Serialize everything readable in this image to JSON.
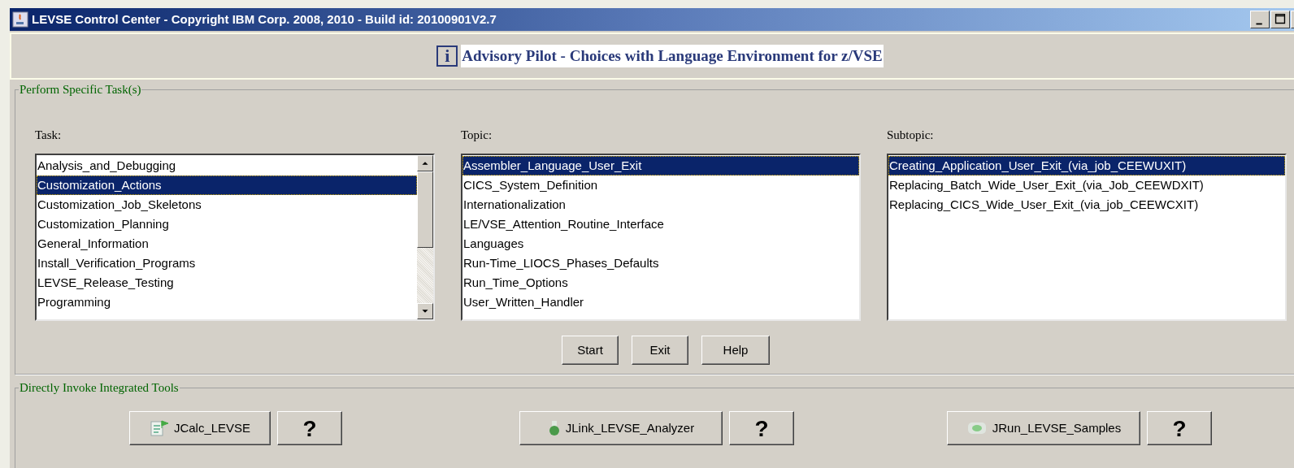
{
  "window": {
    "title": "LEVSE Control Center - Copyright IBM Corp. 2008, 2010 - Build id: 20100901V2.7"
  },
  "header": {
    "info_glyph": "i",
    "text": "Advisory Pilot - Choices with Language Environment for z/VSE"
  },
  "task_group": {
    "title": "Perform Specific Task(s)",
    "lists": [
      {
        "label": "Task:",
        "scrollbar": true,
        "items": [
          {
            "text": "Analysis_and_Debugging",
            "selected": false
          },
          {
            "text": "Customization_Actions",
            "selected": true
          },
          {
            "text": "Customization_Job_Skeletons",
            "selected": false
          },
          {
            "text": "Customization_Planning",
            "selected": false
          },
          {
            "text": "General_Information",
            "selected": false
          },
          {
            "text": "Install_Verification_Programs",
            "selected": false
          },
          {
            "text": "LEVSE_Release_Testing",
            "selected": false
          },
          {
            "text": "Programming",
            "selected": false
          }
        ]
      },
      {
        "label": "Topic:",
        "scrollbar": false,
        "items": [
          {
            "text": "Assembler_Language_User_Exit",
            "selected": true
          },
          {
            "text": "CICS_System_Definition",
            "selected": false
          },
          {
            "text": "Internationalization",
            "selected": false
          },
          {
            "text": "LE/VSE_Attention_Routine_Interface",
            "selected": false
          },
          {
            "text": "Languages",
            "selected": false
          },
          {
            "text": "Run-Time_LIOCS_Phases_Defaults",
            "selected": false
          },
          {
            "text": "Run_Time_Options",
            "selected": false
          },
          {
            "text": "User_Written_Handler",
            "selected": false
          }
        ]
      },
      {
        "label": "Subtopic:",
        "scrollbar": false,
        "items": [
          {
            "text": "Creating_Application_User_Exit_(via_job_CEEWUXIT)",
            "selected": true
          },
          {
            "text": "Replacing_Batch_Wide_User_Exit_(via_Job_CEEWDXIT)",
            "selected": false
          },
          {
            "text": "Replacing_CICS_Wide_User_Exit_(via_job_CEEWCXIT)",
            "selected": false
          }
        ]
      }
    ],
    "buttons": [
      "Start",
      "Exit",
      "Help"
    ]
  },
  "tools_group": {
    "title": "Directly Invoke Integrated Tools",
    "tools": [
      {
        "label": "JCalc_LEVSE",
        "kind": "calc",
        "help": "?"
      },
      {
        "label": "JLink_LEVSE_Analyzer",
        "kind": "link",
        "help": "?"
      },
      {
        "label": "JRun_LEVSE_Samples",
        "kind": "run",
        "help": "?"
      }
    ]
  }
}
